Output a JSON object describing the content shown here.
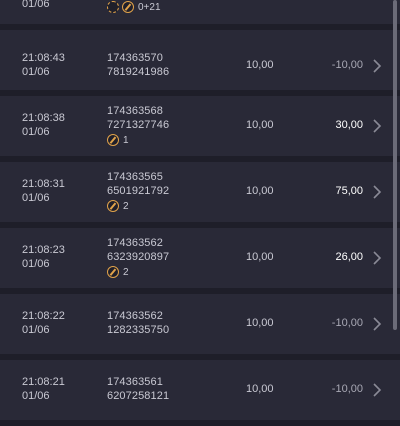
{
  "rows": [
    {
      "time": "",
      "date": "01/06",
      "id1": "",
      "id2": "",
      "stake": "",
      "result": "",
      "badge_count": "0+21"
    },
    {
      "time": "21:08:43",
      "date": "01/06",
      "id1": "174363570",
      "id2": "7819241986",
      "stake": "10,00",
      "result": "-10,00"
    },
    {
      "time": "21:08:38",
      "date": "01/06",
      "id1": "174363568",
      "id2": "7271327746",
      "stake": "10,00",
      "result": "30,00",
      "badge_count": "1"
    },
    {
      "time": "21:08:31",
      "date": "01/06",
      "id1": "174363565",
      "id2": "6501921792",
      "stake": "10,00",
      "result": "75,00",
      "badge_count": "2"
    },
    {
      "time": "21:08:23",
      "date": "01/06",
      "id1": "174363562",
      "id2": "6323920897",
      "stake": "10,00",
      "result": "26,00",
      "badge_count": "2"
    },
    {
      "time": "21:08:22",
      "date": "01/06",
      "id1": "174363562",
      "id2": "1282335750",
      "stake": "10,00",
      "result": "-10,00"
    },
    {
      "time": "21:08:21",
      "date": "01/06",
      "id1": "174363561",
      "id2": "6207258121",
      "stake": "10,00",
      "result": "-10,00"
    }
  ],
  "colors": {
    "positive": "#ffffff",
    "negative": "#a8a8b4",
    "badge": "#e0a24a"
  }
}
